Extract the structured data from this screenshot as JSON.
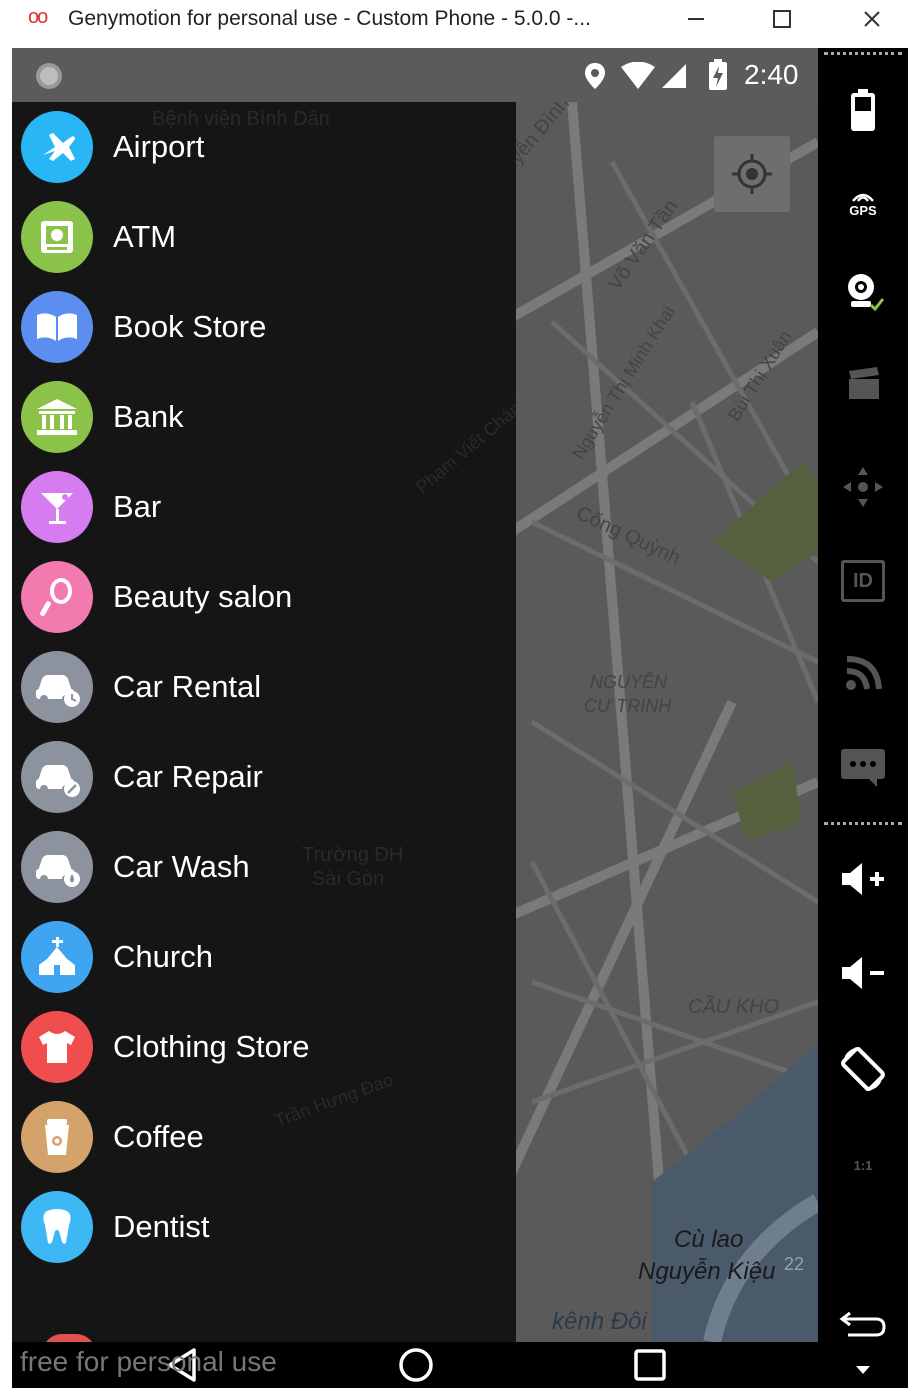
{
  "window": {
    "title": "Genymotion for personal use - Custom Phone - 5.0.0 -...",
    "logo": "oo",
    "minimize": "minimize",
    "maximize": "maximize",
    "close": "close"
  },
  "statusbar": {
    "time": "2:40"
  },
  "map_labels": [
    "Bệnh viện Bình Dân",
    "Nguyễn Đình Chiểu",
    "Võ Văn Tần",
    "Nguyễn Thị Minh Khai",
    "Bùi Thị Xuân",
    "Cống Quỳnh",
    "Phạm Viết Chánh",
    "NGUYỄN",
    "CƯ TRINH",
    "Trường ĐH",
    "Sài Gòn",
    "Trần Hưng Đạo",
    "CẦU KHO",
    "Cù lao",
    "Nguyễn Kiệu",
    "kênh Đôi",
    "22"
  ],
  "drawer": {
    "items": [
      {
        "label": "Airport",
        "icon": "airplane-icon",
        "color": "#29B6F6"
      },
      {
        "label": "ATM",
        "icon": "atm-icon",
        "color": "#8BC34A"
      },
      {
        "label": "Book Store",
        "icon": "book-icon",
        "color": "#5C8DF0"
      },
      {
        "label": "Bank",
        "icon": "bank-icon",
        "color": "#8BC34A"
      },
      {
        "label": "Bar",
        "icon": "cocktail-icon",
        "color": "#D77CF0"
      },
      {
        "label": "Beauty salon",
        "icon": "hand-mirror-icon",
        "color": "#F27AAE"
      },
      {
        "label": "Car Rental",
        "icon": "car-rental-icon",
        "color": "#8D939E"
      },
      {
        "label": "Car Repair",
        "icon": "car-repair-icon",
        "color": "#8D939E"
      },
      {
        "label": "Car Wash",
        "icon": "car-wash-icon",
        "color": "#8D939E"
      },
      {
        "label": "Church",
        "icon": "church-icon",
        "color": "#3FA5F0"
      },
      {
        "label": "Clothing Store",
        "icon": "tshirt-icon",
        "color": "#F04E4E"
      },
      {
        "label": "Coffee",
        "icon": "coffee-cup-icon",
        "color": "#D4A26B"
      },
      {
        "label": "Dentist",
        "icon": "tooth-icon",
        "color": "#3DB8F5"
      }
    ]
  },
  "navbar": {
    "back": "back",
    "home": "home",
    "recents": "recents"
  },
  "watermark": "free for personal use",
  "sidebar": [
    "battery-icon",
    "gps-icon",
    "webcam-icon",
    "capture-icon",
    "dpad-icon",
    "device-id-icon",
    "cast-icon",
    "sms-icon",
    "volume-up-icon",
    "volume-down-icon",
    "rotate-icon",
    "pixel-perfect-icon",
    "back-icon",
    "menu-icon"
  ],
  "gps_label": "GPS",
  "pixel_label": "1:1",
  "id_label": "ID"
}
